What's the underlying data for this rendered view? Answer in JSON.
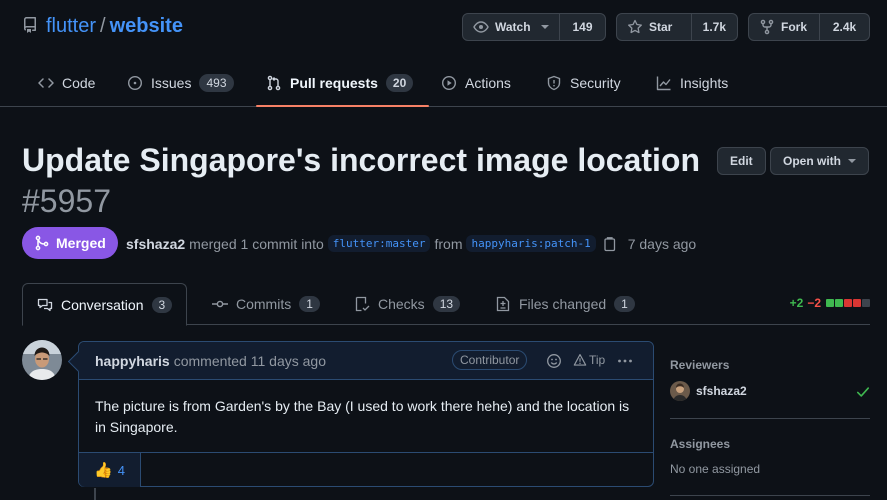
{
  "repo": {
    "owner": "flutter",
    "separator": "/",
    "name": "website"
  },
  "header_buttons": {
    "watch": {
      "label": "Watch",
      "count": "149"
    },
    "star": {
      "label": "Star",
      "count": "1.7k"
    },
    "fork": {
      "label": "Fork",
      "count": "2.4k"
    }
  },
  "tabs": [
    {
      "label": "Code",
      "count": ""
    },
    {
      "label": "Issues",
      "count": "493"
    },
    {
      "label": "Pull requests",
      "count": "20"
    },
    {
      "label": "Actions",
      "count": ""
    },
    {
      "label": "Security",
      "count": ""
    },
    {
      "label": "Insights",
      "count": ""
    }
  ],
  "pr": {
    "title": "Update Singapore's incorrect image location",
    "number": "#5957",
    "state": "Merged",
    "author": "sfshaza2",
    "merged_text": "merged 1 commit into",
    "base_branch": "flutter:master",
    "from_text": "from",
    "head_branch": "happyharis:patch-1",
    "time": "7 days ago"
  },
  "actions": {
    "edit": "Edit",
    "open_with": "Open with"
  },
  "pr_tabs": [
    {
      "label": "Conversation",
      "count": "3"
    },
    {
      "label": "Commits",
      "count": "1"
    },
    {
      "label": "Checks",
      "count": "13"
    },
    {
      "label": "Files changed",
      "count": "1"
    }
  ],
  "diffstat": {
    "additions": "+2",
    "deletions": "−2",
    "boxes": [
      "add",
      "add",
      "del",
      "del",
      "neutral"
    ],
    "colors": {
      "add": "#3fb950",
      "del": "#da3633",
      "neutral": "#3d444d"
    }
  },
  "comment": {
    "author": "happyharis",
    "action": "commented 11 days ago",
    "badge": "Contributor",
    "tip": "Tip",
    "body": "The picture is from Garden's by the Bay (I used to work there hehe) and the location is in Singapore.",
    "reaction": {
      "emoji": "👍",
      "count": "4"
    }
  },
  "sidebar": {
    "reviewers_heading": "Reviewers",
    "reviewer": "sfshaza2",
    "assignees_heading": "Assignees",
    "assignees_value": "No one assigned"
  },
  "colors": {
    "accent": "#4493f8",
    "merged": "#8957e5",
    "tab_underline": "#f78166",
    "approved": "#3fb950"
  }
}
